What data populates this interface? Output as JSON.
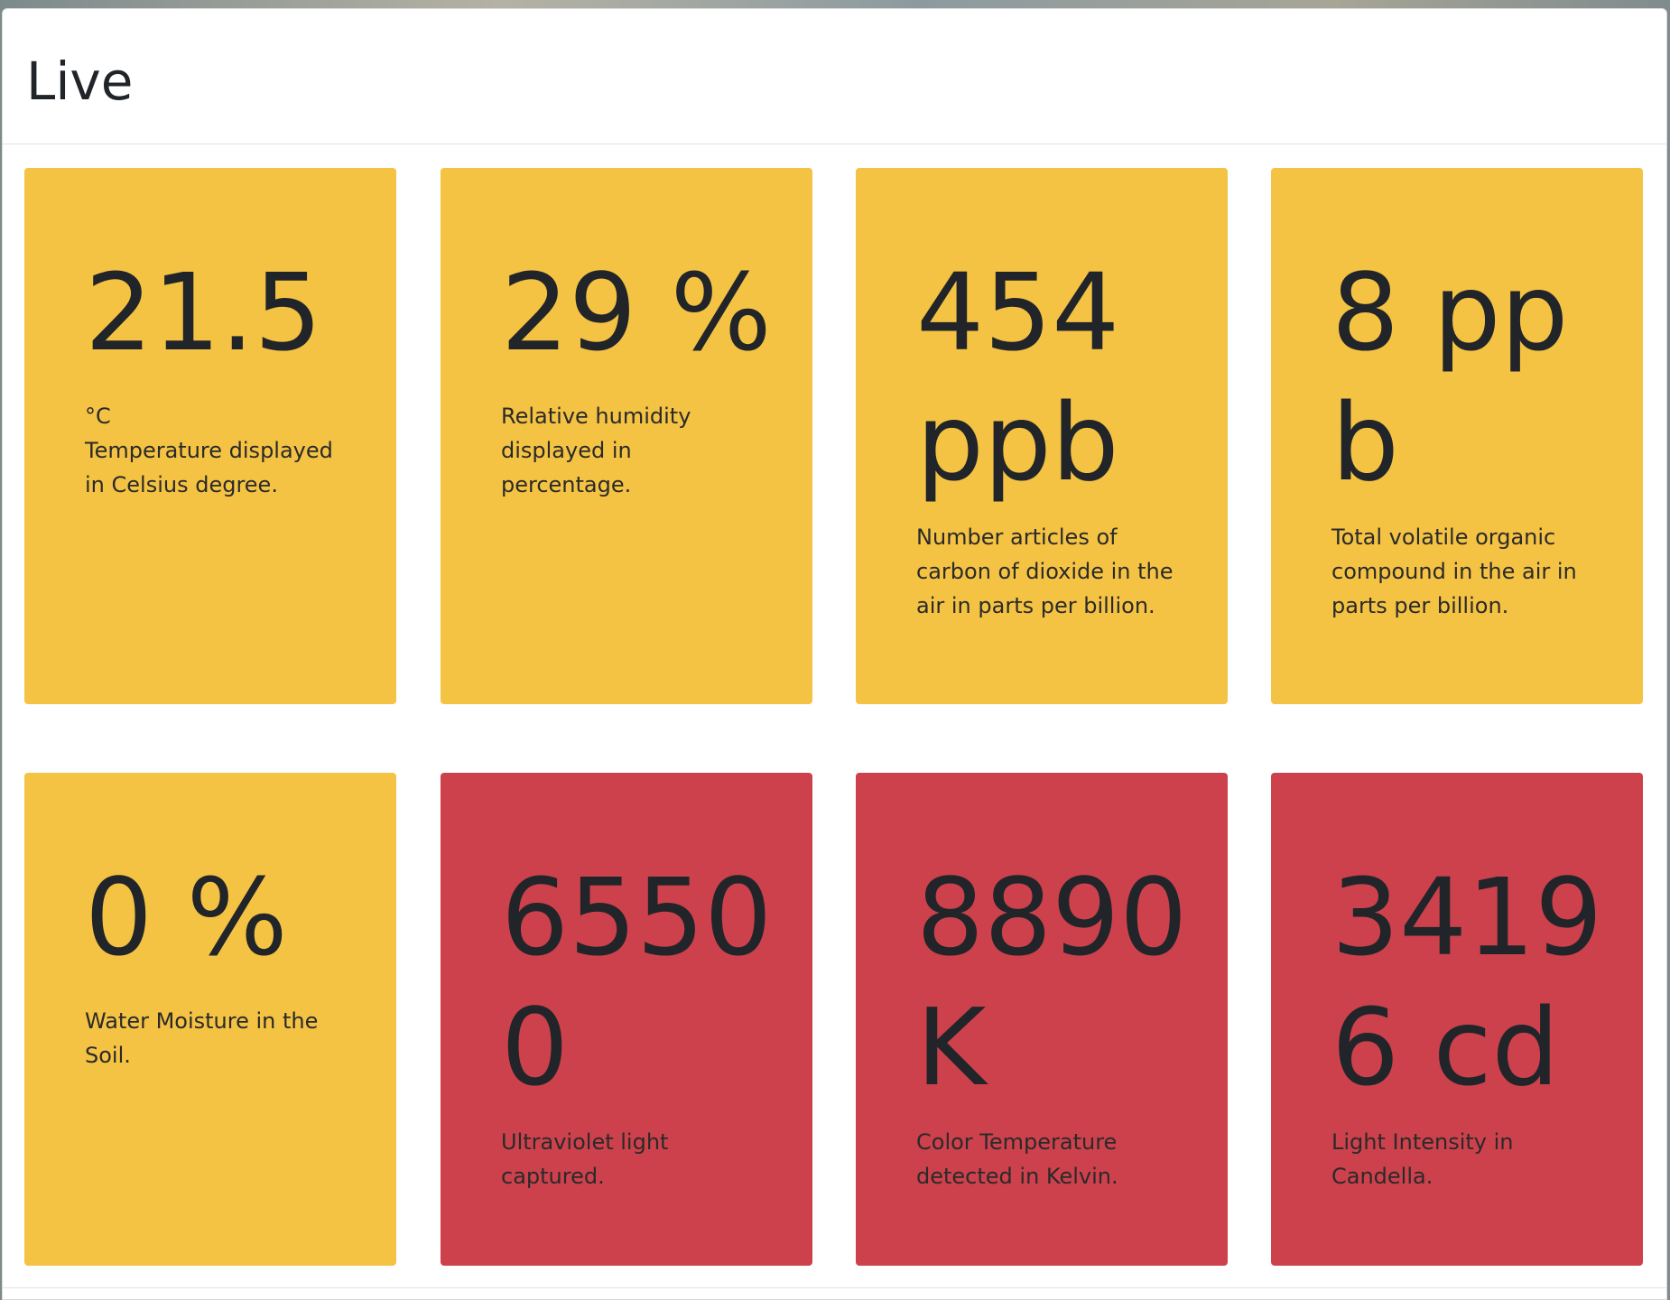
{
  "modal": {
    "title": "Live"
  },
  "cards": [
    {
      "value": "21.5",
      "unit_line": "°C",
      "description": "Temperature displayed in Celsius degree.",
      "status_color": "#f5c343"
    },
    {
      "value": "29 %",
      "description": "Relative humidity displayed in percentage.",
      "status_color": "#f5c343"
    },
    {
      "value": "454 ppb",
      "description": "Number articles of carbon of dioxide in the air in parts per billion.",
      "status_color": "#f5c343"
    },
    {
      "value": "8 ppb",
      "description": "Total volatile organic compound in the air in parts per billion.",
      "status_color": "#f5c343"
    },
    {
      "value": "0 %",
      "description": "Water Moisture in the Soil.",
      "status_color": "#f5c343"
    },
    {
      "value": "65500",
      "description": "Ultraviolet light captured.",
      "status_color": "#cc414c"
    },
    {
      "value": "8890 K",
      "description": "Color Temperature detected in Kelvin.",
      "status_color": "#cc414c"
    },
    {
      "value": "34196 cd",
      "description": "Light Intensity in Candella.",
      "status_color": "#cc414c"
    }
  ]
}
